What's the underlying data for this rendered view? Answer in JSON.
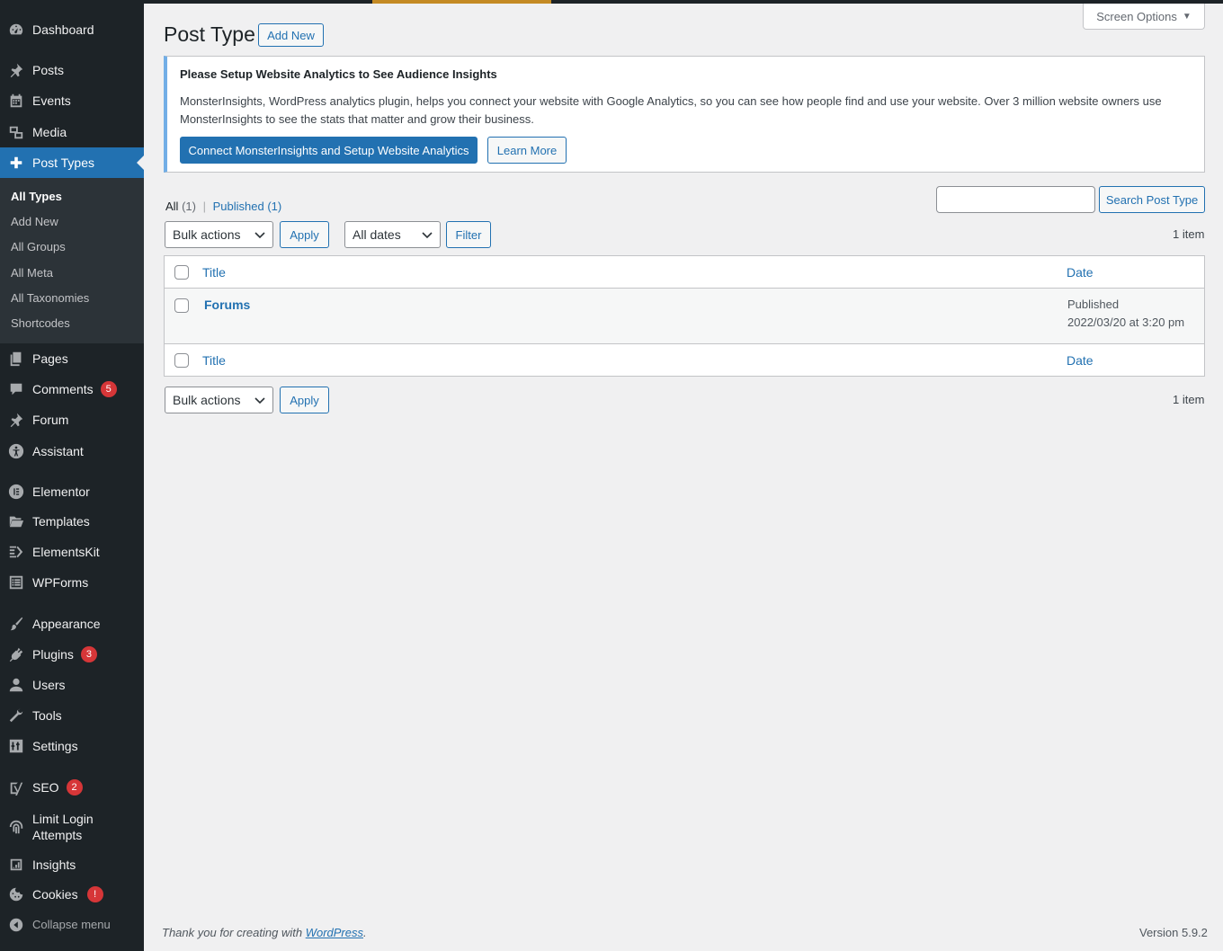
{
  "sidebar": {
    "items": [
      {
        "key": "dashboard",
        "label": "Dashboard"
      },
      {
        "key": "posts",
        "label": "Posts"
      },
      {
        "key": "events",
        "label": "Events"
      },
      {
        "key": "media",
        "label": "Media"
      },
      {
        "key": "post-types",
        "label": "Post Types"
      },
      {
        "key": "pages",
        "label": "Pages"
      },
      {
        "key": "comments",
        "label": "Comments",
        "badge": "5"
      },
      {
        "key": "forum",
        "label": "Forum"
      },
      {
        "key": "assistant",
        "label": "Assistant"
      },
      {
        "key": "elementor",
        "label": "Elementor"
      },
      {
        "key": "templates",
        "label": "Templates"
      },
      {
        "key": "elementskit",
        "label": "ElementsKit"
      },
      {
        "key": "wpforms",
        "label": "WPForms"
      },
      {
        "key": "appearance",
        "label": "Appearance"
      },
      {
        "key": "plugins",
        "label": "Plugins",
        "badge": "3"
      },
      {
        "key": "users",
        "label": "Users"
      },
      {
        "key": "tools",
        "label": "Tools"
      },
      {
        "key": "settings",
        "label": "Settings"
      },
      {
        "key": "seo",
        "label": "SEO",
        "badge": "2"
      },
      {
        "key": "limit-login",
        "label": "Limit Login Attempts"
      },
      {
        "key": "insights",
        "label": "Insights"
      },
      {
        "key": "cookies",
        "label": "Cookies",
        "badge": "!"
      },
      {
        "key": "collapse",
        "label": "Collapse menu"
      }
    ],
    "submenu": [
      "All Types",
      "Add New",
      "All Groups",
      "All Meta",
      "All Taxonomies",
      "Shortcodes"
    ]
  },
  "header": {
    "title": "Post Type",
    "add_new": "Add New",
    "screen_options": "Screen Options"
  },
  "notice": {
    "title": "Please Setup Website Analytics to See Audience Insights",
    "text": "MonsterInsights, WordPress analytics plugin, helps you connect your website with Google Analytics, so you can see how people find and use your website. Over 3 million website owners use MonsterInsights to see the stats that matter and grow their business.",
    "primary_button": "Connect MonsterInsights and Setup Website Analytics",
    "secondary_button": "Learn More"
  },
  "filters": {
    "all_label": "All",
    "all_count": "(1)",
    "published_label": "Published",
    "published_count": "(1)",
    "search_button": "Search Post Type",
    "bulk_actions": "Bulk actions",
    "apply": "Apply",
    "all_dates": "All dates",
    "filter": "Filter",
    "item_count": "1 item"
  },
  "table": {
    "columns": [
      "Title",
      "Date"
    ],
    "rows": [
      {
        "title": "Forums",
        "status": "Published",
        "date": "2022/03/20 at 3:20 pm"
      }
    ]
  },
  "footer": {
    "thanks_prefix": "Thank you for creating with ",
    "thanks_link": "WordPress",
    "thanks_suffix": ".",
    "version": "Version 5.9.2"
  },
  "colors": {
    "sidebar_bg": "#1d2327",
    "submenu_bg": "#2c3338",
    "accent": "#2271b1",
    "badge": "#d63638",
    "notice_border": "#72aee6",
    "topbar_highlight": "#c48a24"
  }
}
